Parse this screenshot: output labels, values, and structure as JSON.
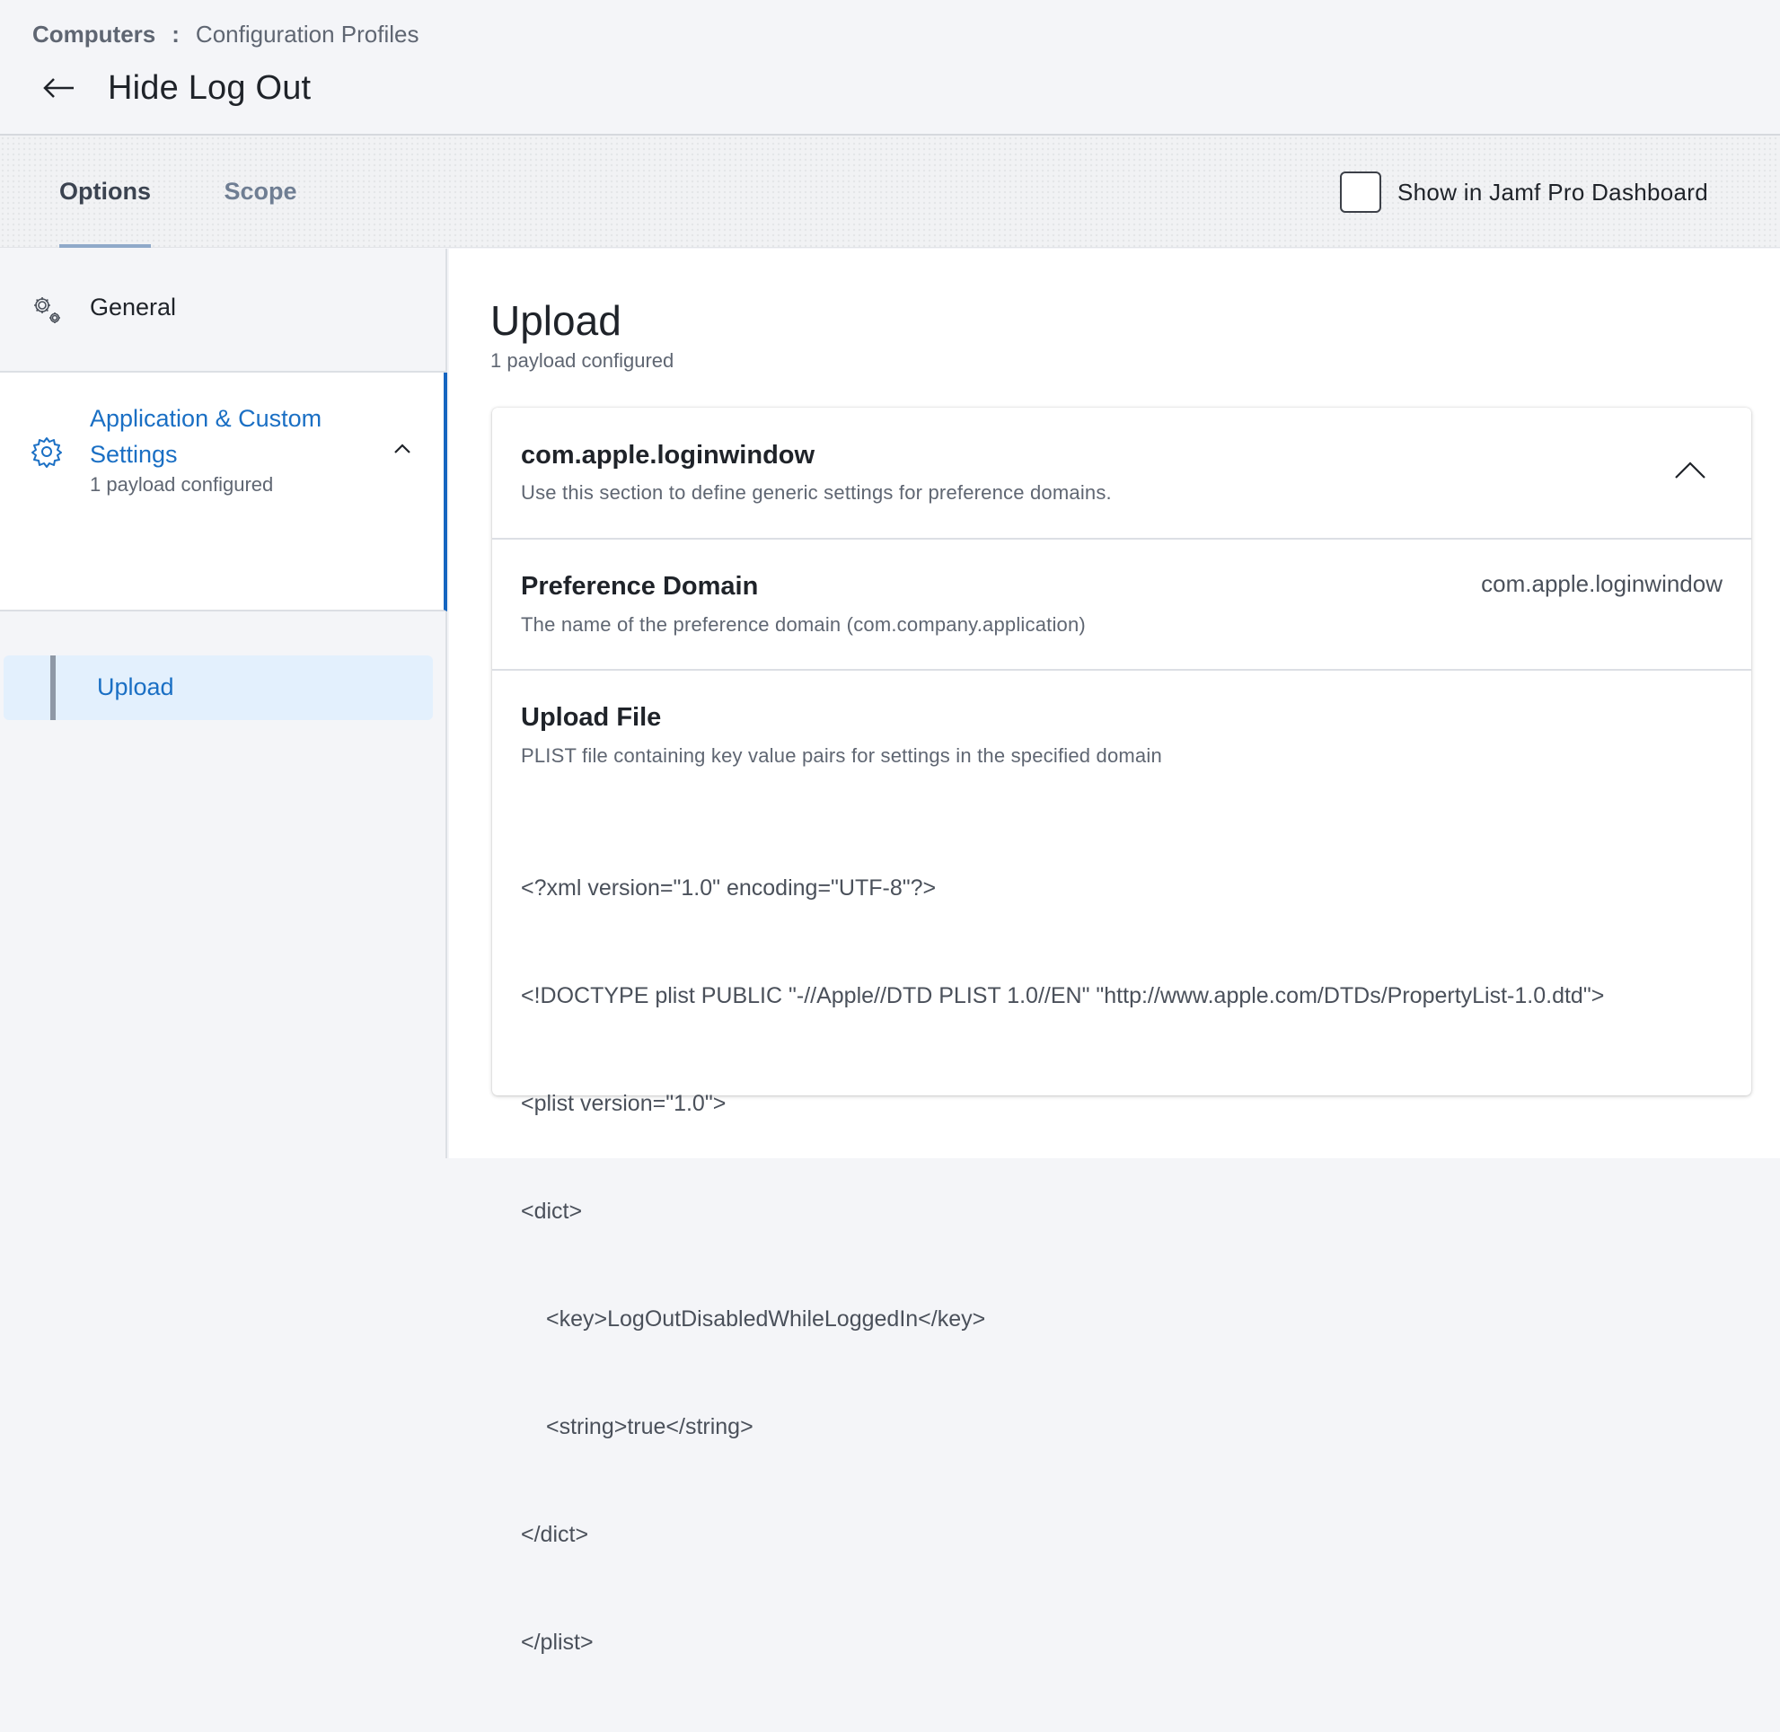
{
  "breadcrumb": {
    "root": "Computers",
    "separator": ":",
    "current": "Configuration Profiles"
  },
  "page": {
    "title": "Hide Log Out",
    "back_icon": "arrow-left-icon"
  },
  "tabs": [
    {
      "label": "Options",
      "active": true
    },
    {
      "label": "Scope",
      "active": false
    }
  ],
  "dashboard_toggle": {
    "label": "Show in Jamf Pro Dashboard",
    "checked": false
  },
  "sidebar": {
    "general": {
      "label": "General",
      "icon": "gears-icon"
    },
    "app_custom": {
      "label": "Application & Custom Settings",
      "subtitle": "1 payload configured",
      "icon": "gear-icon",
      "expanded": true,
      "active_color": "#1565c0"
    },
    "upload": {
      "label": "Upload",
      "selected": true
    }
  },
  "main": {
    "title": "Upload",
    "subtitle": "1 payload configured",
    "card": {
      "header": {
        "title": "com.apple.loginwindow",
        "description": "Use this section to define generic settings for preference domains."
      },
      "preference_domain": {
        "title": "Preference Domain",
        "description": "The name of the preference domain (com.company.application)",
        "value": "com.apple.loginwindow"
      },
      "upload_file": {
        "title": "Upload File",
        "description": "PLIST file containing key value pairs for settings in the specified domain",
        "content_lines": [
          "<?xml version=\"1.0\" encoding=\"UTF-8\"?>",
          "<!DOCTYPE plist PUBLIC \"-//Apple//DTD PLIST 1.0//EN\" \"http://www.apple.com/DTDs/PropertyList-1.0.dtd\">",
          "<plist version=\"1.0\">",
          "<dict>",
          "<key>LogOutDisabledWhileLoggedIn</key>",
          "<string>true</string>",
          "</dict>",
          "</plist>"
        ]
      }
    }
  },
  "colors": {
    "accent": "#1a6fc4",
    "selected_bg": "#e3f0fd",
    "tab_underline": "#8fa9c9"
  }
}
